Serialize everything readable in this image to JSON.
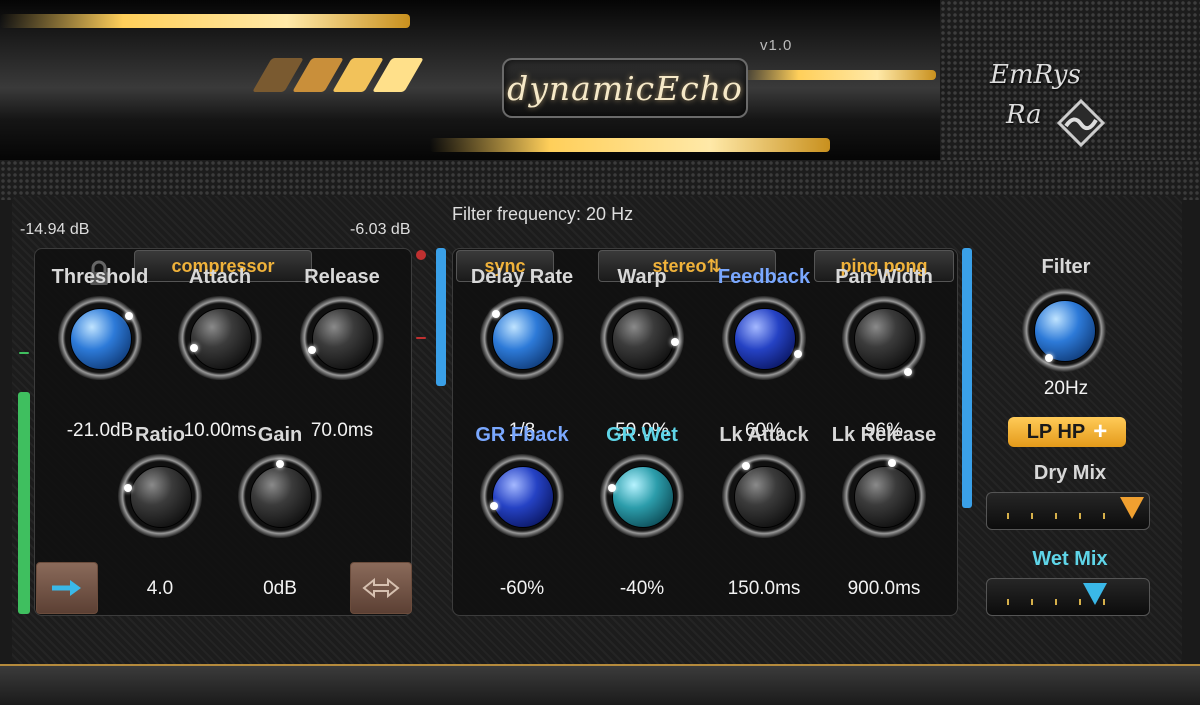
{
  "header": {
    "title": "dynamicEcho",
    "version": "v1.0",
    "brand_line1": "EmRys",
    "brand_line2": "Ra",
    "stripe_colors": [
      "#7a5a30",
      "#c98f3a",
      "#f2c25a",
      "#ffe08a"
    ]
  },
  "meters": {
    "input_db": "-14.94 dB",
    "output_db": "-6.03 dB",
    "level_color": "#3fbf5f",
    "accent_color": "#3aa0e8"
  },
  "status": {
    "filter_frequency": "Filter frequency: 20 Hz"
  },
  "compressor": {
    "title": "compressor",
    "lock_icon": "padlock-icon",
    "knobs": [
      {
        "label": "Threshold",
        "value": "-21.0dB",
        "style": "blue"
      },
      {
        "label": "Attach",
        "value": "10.00ms",
        "style": "black"
      },
      {
        "label": "Release",
        "value": "70.0ms",
        "style": "black"
      },
      {
        "label": "Ratio",
        "value": "4.0",
        "style": "black"
      },
      {
        "label": "Gain",
        "value": "0dB",
        "style": "black"
      }
    ],
    "left_button_icon": "arrow-right-icon",
    "right_button_icon": "arrows-horizontal-icon"
  },
  "delay": {
    "sync_label": "sync",
    "stereo_label": "stereo⇅",
    "pingpong_label": "ping pong",
    "knobs": [
      {
        "label": "Delay Rate",
        "value": "1/8",
        "style": "blue",
        "color": "default"
      },
      {
        "label": "Warp",
        "value": "50.0%",
        "style": "black",
        "color": "default"
      },
      {
        "label": "Feedback",
        "value": "60%",
        "style": "dblue",
        "color": "blue"
      },
      {
        "label": "Pan Width",
        "value": "96%",
        "style": "black",
        "color": "default"
      },
      {
        "label": "GR Fback",
        "value": "-60%",
        "style": "dblue",
        "color": "blue"
      },
      {
        "label": "GR Wet",
        "value": "-40%",
        "style": "teal",
        "color": "cyan"
      },
      {
        "label": "Lk Attack",
        "value": "150.0ms",
        "style": "black",
        "color": "default"
      },
      {
        "label": "Lk Release",
        "value": "900.0ms",
        "style": "black",
        "color": "default"
      }
    ]
  },
  "filter": {
    "label": "Filter",
    "value": "20Hz",
    "lphp_label": "LP HP",
    "plus_label": "+",
    "dry_mix_label": "Dry Mix",
    "wet_mix_label": "Wet Mix",
    "dry_mix_color": "#f0a030",
    "wet_mix_color": "#3ab8e8"
  }
}
